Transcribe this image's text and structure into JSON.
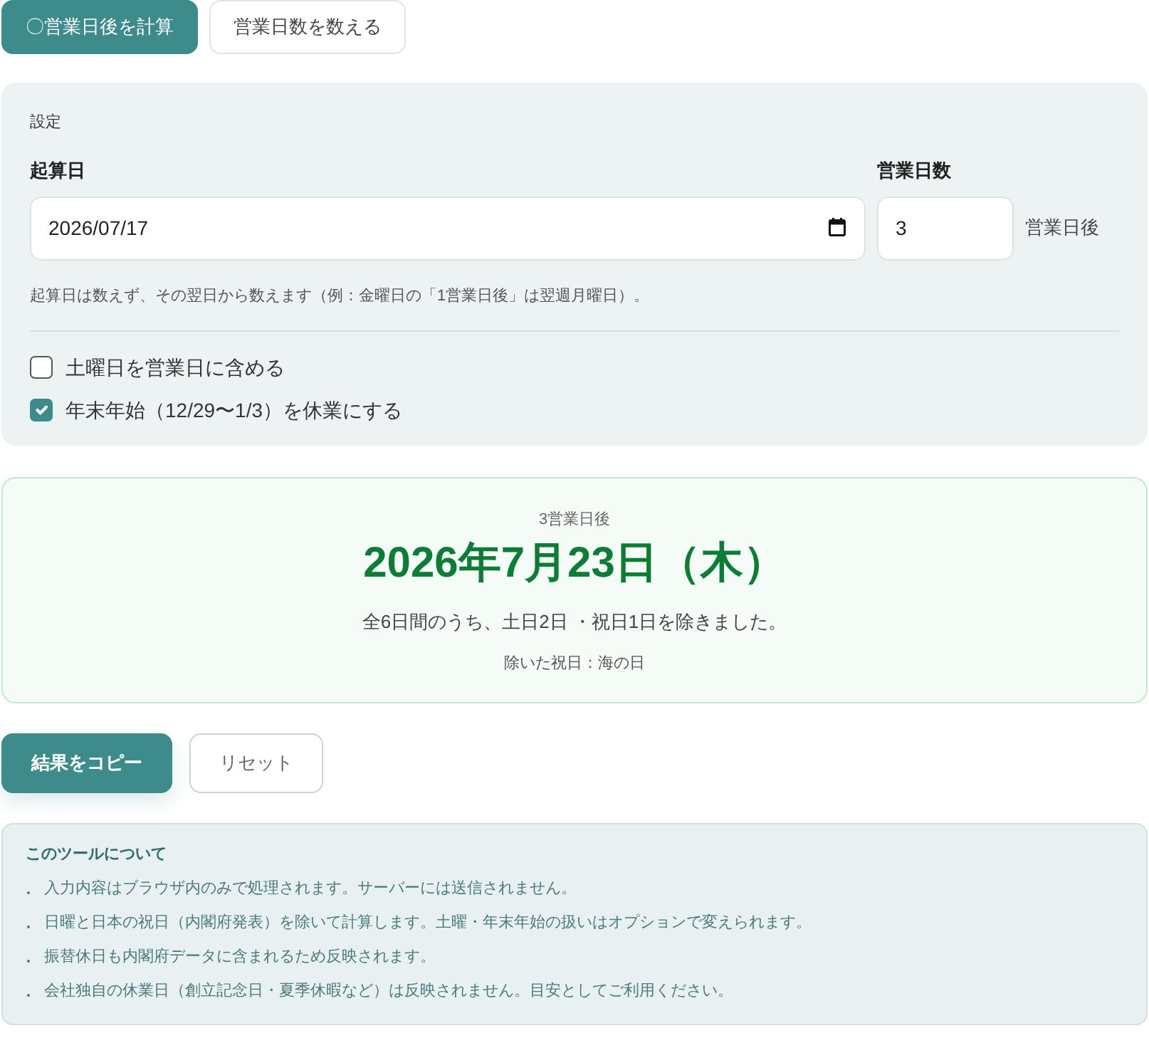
{
  "tabs": [
    {
      "label": "〇営業日後を計算",
      "selected": true
    },
    {
      "label": "営業日数を数える",
      "selected": false
    }
  ],
  "settings": {
    "title": "設定",
    "start_date": {
      "label": "起算日",
      "value": "2026/07/17"
    },
    "business_days": {
      "label": "営業日数",
      "value": "3",
      "suffix": "営業日後"
    },
    "hint": "起算日は数えず、その翌日から数えます（例：金曜日の「1営業日後」は翌週月曜日）。",
    "options": [
      {
        "label": "土曜日を営業日に含める",
        "checked": false
      },
      {
        "label": "年末年始（12/29〜1/3）を休業にする",
        "checked": true
      }
    ]
  },
  "result": {
    "caption": "3営業日後",
    "date": "2026年7月23日（木）",
    "summary": "全6日間のうち、土日2日 ・祝日1日を除きました。",
    "holidays": "除いた祝日：海の日"
  },
  "actions": [
    {
      "label": "結果をコピー",
      "kind": "primary"
    },
    {
      "label": "リセット",
      "kind": "secondary"
    }
  ],
  "about": {
    "title": "このツールについて",
    "items": [
      "入力内容はブラウザ内のみで処理されます。サーバーには送信されません。",
      "日曜と日本の祝日（内閣府発表）を除いて計算します。土曜・年末年始の扱いはオプションで変えられます。",
      "振替休日も内閣府データに含まれるため反映されます。",
      "会社独自の休業日（創立記念日・夏季休暇など）は反映されません。目安としてご利用ください。"
    ]
  }
}
